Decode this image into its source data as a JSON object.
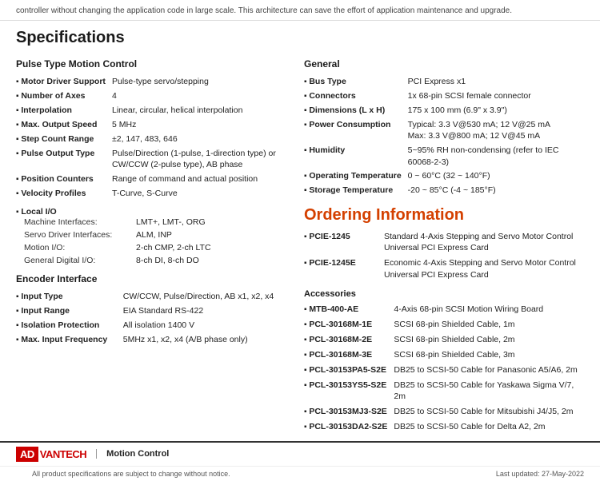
{
  "top_banner": {
    "text": "controller without changing the application code in large scale. This architecture can save the effort of application maintenance and upgrade."
  },
  "page_title": "Specifications",
  "pulse_type": {
    "section_title": "Pulse Type Motion Control",
    "specs": [
      {
        "label": "Motor Driver Support",
        "value": "Pulse-type servo/stepping"
      },
      {
        "label": "Number of Axes",
        "value": "4"
      },
      {
        "label": "Interpolation",
        "value": "Linear, circular, helical interpolation"
      },
      {
        "label": "Max. Output Speed",
        "value": "5 MHz"
      },
      {
        "label": "Step Count Range",
        "value": "±2, 147, 483, 646"
      },
      {
        "label": "Pulse Output Type",
        "value": "Pulse/Direction (1-pulse, 1-direction type) or CW/CCW (2-pulse type), AB phase"
      },
      {
        "label": "Position Counters",
        "value": "Range of command and actual position"
      },
      {
        "label": "Velocity Profiles",
        "value": "T-Curve, S-Curve"
      }
    ],
    "local_io": {
      "label": "Local I/O",
      "rows": [
        {
          "sub_label": "Machine Interfaces:",
          "value": "LMT+, LMT-, ORG"
        },
        {
          "sub_label": "Servo Driver Interfaces:",
          "value": "ALM, INP"
        },
        {
          "sub_label": "Motion I/O:",
          "value": "2-ch CMP, 2-ch LTC"
        },
        {
          "sub_label": "General Digital I/O:",
          "value": "8-ch DI, 8-ch DO"
        }
      ]
    }
  },
  "encoder": {
    "section_title": "Encoder Interface",
    "specs": [
      {
        "label": "Input Type",
        "value": "CW/CCW, Pulse/Direction, AB x1, x2, x4"
      },
      {
        "label": "Input Range",
        "value": "EIA Standard RS-422"
      },
      {
        "label": "Isolation Protection",
        "value": "All isolation 1400 V"
      },
      {
        "label": "Max. Input Frequency",
        "value": "5MHz x1, x2, x4 (A/B phase only)"
      }
    ]
  },
  "general": {
    "section_title": "General",
    "specs": [
      {
        "label": "Bus Type",
        "value": "PCI Express x1"
      },
      {
        "label": "Connectors",
        "value": "1x 68-pin SCSI female connector"
      },
      {
        "label": "Dimensions (L x H)",
        "value": "175 x 100 mm (6.9\" x 3.9\")"
      },
      {
        "label": "Power Consumption",
        "value": "Typical: 3.3 V@530 mA; 12 V@25 mA\nMax: 3.3 V@800 mA; 12 V@45 mA"
      },
      {
        "label": "Humidity",
        "value": "5~95% RH non-condensing (refer to IEC 60068-2-3)"
      },
      {
        "label": "Operating Temperature",
        "value": "0 ~ 60°C (32 ~ 140°F)"
      },
      {
        "label": "Storage Temperature",
        "value": "-20 ~ 85°C (-4 ~ 185°F)"
      }
    ]
  },
  "ordering": {
    "section_title": "Ordering Information",
    "items": [
      {
        "label": "PCIE-1245",
        "value": "Standard 4-Axis Stepping and Servo Motor Control Universal PCI Express Card"
      },
      {
        "label": "PCIE-1245E",
        "value": "Economic 4-Axis Stepping and Servo Motor Control Universal PCI Express Card"
      }
    ],
    "accessories_title": "Accessories",
    "accessories": [
      {
        "label": "MTB-400-AE",
        "value": "4-Axis 68-pin SCSI Motion Wiring Board"
      },
      {
        "label": "PCL-30168M-1E",
        "value": "SCSI 68-pin Shielded Cable, 1m"
      },
      {
        "label": "PCL-30168M-2E",
        "value": "SCSI 68-pin Shielded Cable, 2m"
      },
      {
        "label": "PCL-30168M-3E",
        "value": "SCSI 68-pin Shielded Cable, 3m"
      },
      {
        "label": "PCL-30153PA5-S2E",
        "value": "DB25 to SCSI-50 Cable for Panasonic A5/A6, 2m"
      },
      {
        "label": "PCL-30153YS5-S2E",
        "value": "DB25 to SCSI-50 Cable for Yaskawa Sigma V/7, 2m"
      },
      {
        "label": "PCL-30153MJ3-S2E",
        "value": "DB25 to SCSI-50 Cable for Mitsubishi J4/J5, 2m"
      },
      {
        "label": "PCL-30153DA2-S2E",
        "value": "DB25 to SCSI-50 Cable for Delta A2, 2m"
      }
    ]
  },
  "footer": {
    "logo_ad": "AD",
    "logo_vantech": "VANTECH",
    "section": "Motion Control",
    "disclaimer": "All product specifications are subject to change without notice.",
    "last_updated": "Last updated: 27-May-2022"
  }
}
